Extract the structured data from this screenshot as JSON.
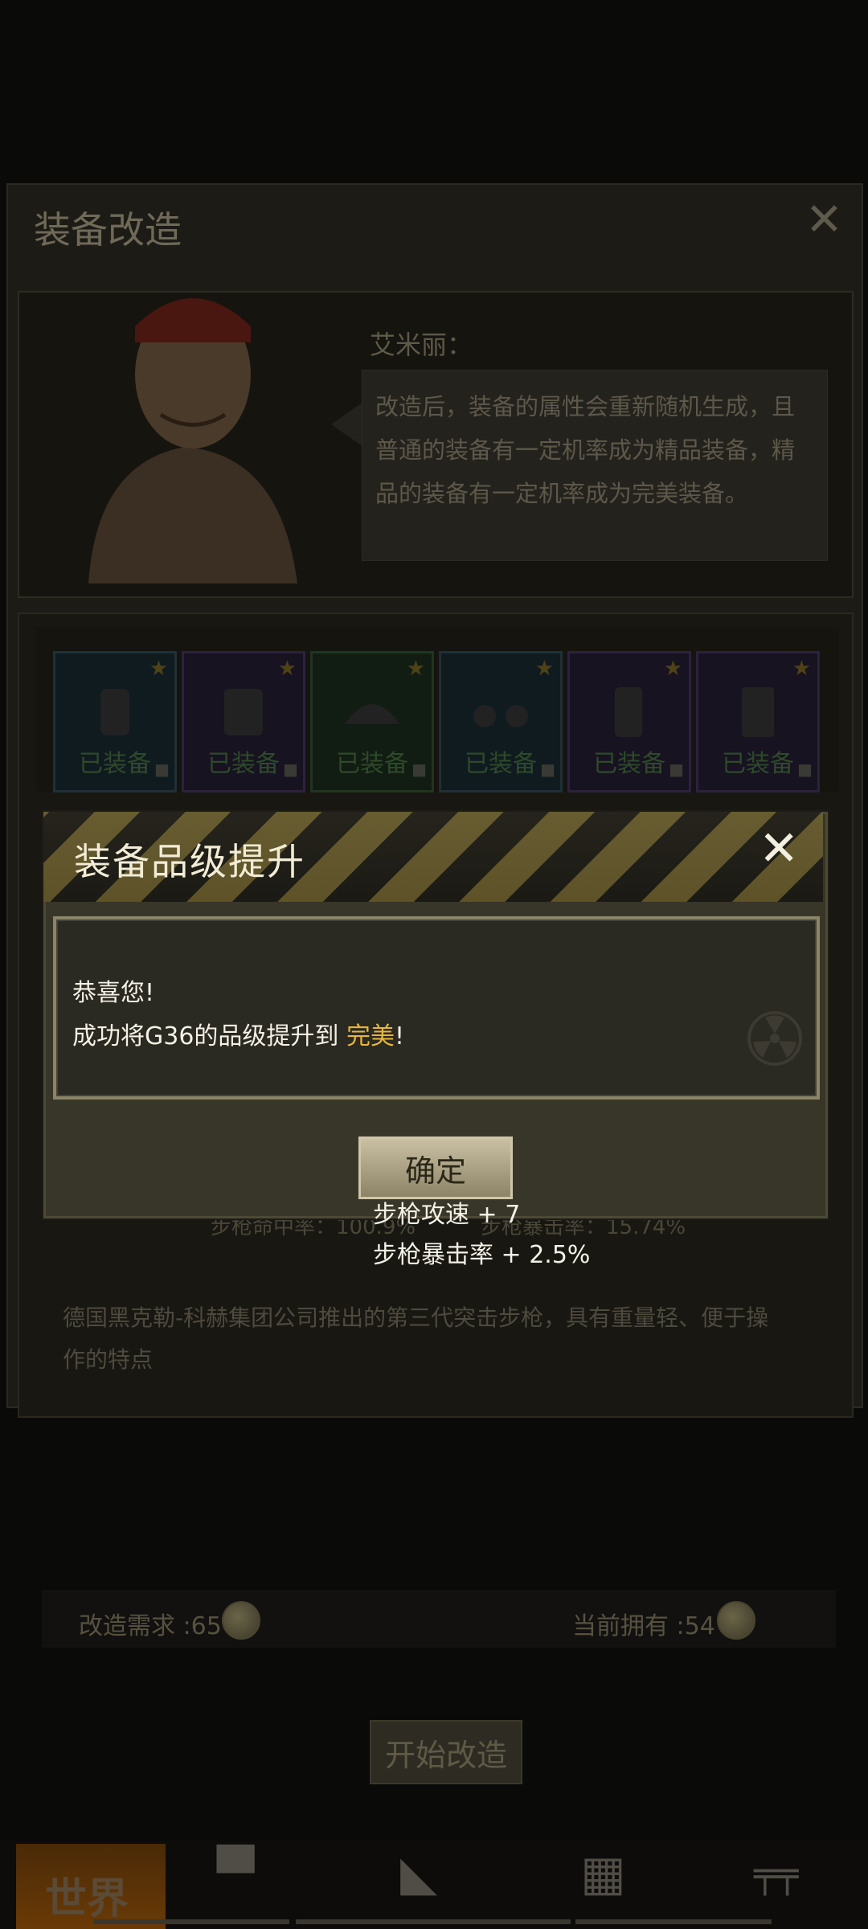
{
  "background": {
    "panel_title": "装备改造",
    "npc_name": "艾米丽：",
    "npc_speech": "改造后，装备的属性会重新随机生成，且普通的装备有一定机率成为精品装备，精品的装备有一定机率成为完美装备。",
    "slots": [
      {
        "label": "已装备"
      },
      {
        "label": "已装备"
      },
      {
        "label": "已装备"
      },
      {
        "label": "已装备"
      },
      {
        "label": "已装备"
      },
      {
        "label": "已装备"
      }
    ],
    "faded_stats_left": "步枪命中率：100.9%",
    "faded_stats_right": "步枪暴击率：15.74%",
    "description": "德国黑克勒-科赫集团公司推出的第三代突击步枪，具有重量轻、便于操作的特点",
    "cost_required": "改造需求 :65",
    "cost_owned": "当前拥有 :54",
    "start_button": "开始改造"
  },
  "nav": {
    "world_label": "世界"
  },
  "dialog": {
    "title": "装备品级提升",
    "message_line1": "恭喜您!",
    "message_line2_prefix": "成功将G36的品级提升到 ",
    "message_quality": "完美",
    "message_line2_suffix": "!",
    "confirm_label": "确定"
  },
  "stats": {
    "line1": "步枪攻速 + 7",
    "line2": "步枪暴击率 + 2.5%"
  },
  "colors": {
    "quality_highlight": "#e8b63a",
    "hazard_yellow": "#a9933e"
  }
}
